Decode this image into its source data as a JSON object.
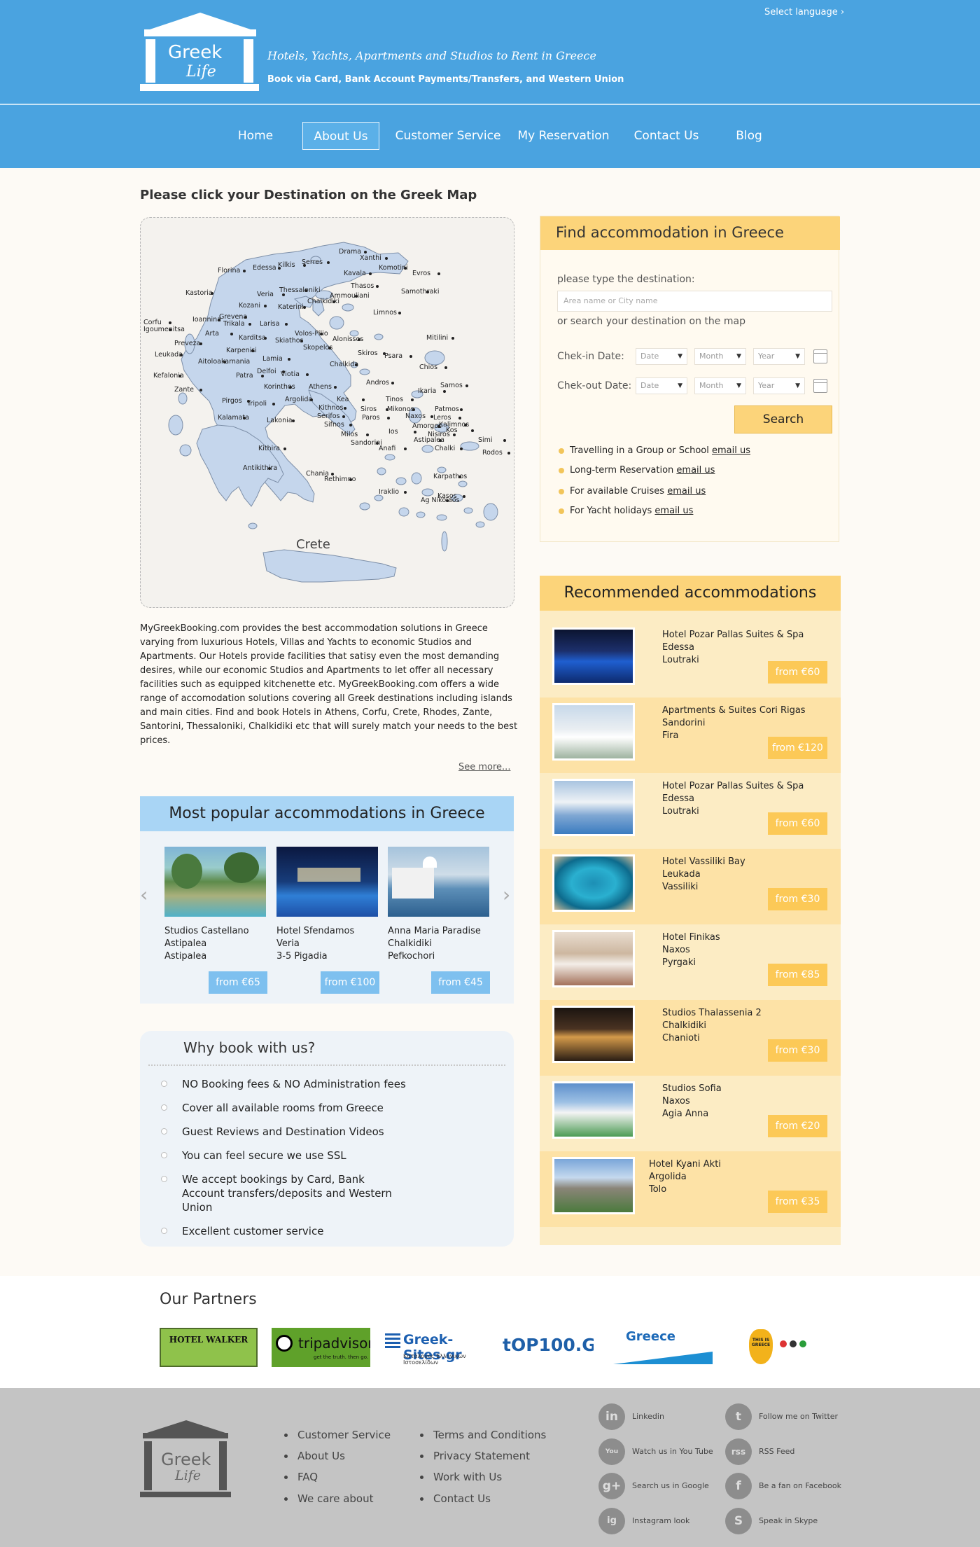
{
  "header": {
    "logo_line1": "Greek",
    "logo_line2": "Life",
    "tagline": "Hotels, Yachts, Apartments and Studios to Rent in Greece",
    "subtagline": "Book via Card, Bank Account Payments/Transfers, and Western Union",
    "select_language": "Select language ›"
  },
  "nav": {
    "items": [
      "Home",
      "About Us",
      "Customer Service",
      "My Reservation",
      "Contact Us",
      "Blog"
    ],
    "active": "About Us"
  },
  "map": {
    "title": "Please click your Destination on the Greek Map",
    "crete_label": "Crete",
    "cities": [
      "Drama",
      "Xanthi",
      "Komotini",
      "Evros",
      "Florina",
      "Edessa",
      "Kilkis",
      "Serres",
      "Kavala",
      "Thasos",
      "Samothraki",
      "Kastoria",
      "Veria",
      "Thessaloniki",
      "Ammouliani",
      "Chalkidiki",
      "Kozani",
      "Katerini",
      "Grevena",
      "Limnos",
      "Corfu",
      "Igoumenitsa",
      "Ioannina",
      "Trikala",
      "Larisa",
      "Volos-Pilio",
      "Arta",
      "Karditsa",
      "Skiathos",
      "Alonissos",
      "Mitilini",
      "Preveza",
      "Skopelos",
      "Karpenisi",
      "Skiros",
      "Psara",
      "Leukada",
      "Lamia",
      "Chalkida",
      "Chios",
      "Aitoloakarnania",
      "Delfoi",
      "Kefalonia",
      "Patra",
      "Viotia",
      "Andros",
      "Samos",
      "Zante",
      "Korinthos",
      "Athens",
      "Ikaria",
      "Argolida",
      "Kea",
      "Tinos",
      "Pirgos",
      "Tripoli",
      "Kithnos",
      "Mikonos",
      "Patmos",
      "Serifos",
      "Siros",
      "Paros",
      "Naxos",
      "Leros",
      "Kalimnos",
      "Kalamata",
      "Lakonia",
      "Sifnos",
      "Amorgos",
      "Kos",
      "Milos",
      "Ios",
      "Nisiros",
      "Sandorini",
      "Astipalea",
      "Simi",
      "Anafi",
      "Chalki",
      "Rodos",
      "Kithira",
      "Antikithira",
      "Karpathos",
      "Chania",
      "Rethimno",
      "Kasos",
      "Iraklio",
      "Ag Nikolaos"
    ]
  },
  "intro": {
    "text": "MyGreekBooking.com provides the best accommodation solutions in Greece varying from luxurious Hotels, Villas and Yachts to economic Studios and Apartments. Our Hotels provide facilities that satisy even the most demanding desires, while our economic Studios and Apartments to let offer all necessary facilities such as equipped kitchenette etc. MyGreekBooking.com offers a wide range of accomodation solutions covering all Greek destinations including islands and main cities. Find and book Hotels in Athens, Corfu, Crete, Rhodes, Zante, Santorini, Thessaloniki, Chalkidiki etc that will surely match your needs to the best prices.",
    "see_more": "See more..."
  },
  "popular": {
    "title": "Most popular accommodations in Greece",
    "items": [
      {
        "name": "Studios Castellano",
        "line2": "Astipalea",
        "line3": "Astipalea",
        "price": "from €65"
      },
      {
        "name": "Hotel Sfendamos",
        "line2": "Veria",
        "line3": "3-5 Pigadia",
        "price": "from €100"
      },
      {
        "name": "Anna Maria Paradise",
        "line2": "Chalkidiki",
        "line3": "Pefkochori",
        "price": "from €45"
      }
    ]
  },
  "why": {
    "title": "Why book with us?",
    "items": [
      "NO Booking fees & NO Administration fees",
      "Cover all available rooms from Greece",
      "Guest Reviews and Destination Videos",
      "You can feel secure we use SSL",
      "We accept bookings by Card, Bank Account transfers/deposits and Western Union",
      "Excellent customer service"
    ]
  },
  "find": {
    "title": "Find accommodation in Greece",
    "type_label": "please type the destination:",
    "placeholder": "Area name or City name",
    "or_map": "or search your destination on the map",
    "checkin": "Chek-in Date:",
    "checkout": "Chek-out Date:",
    "date": "Date",
    "month": "Month",
    "year": "Year",
    "search": "Search",
    "lines": [
      {
        "text": "Travelling in a Group or School",
        "link": "email us"
      },
      {
        "text": "Long-term Reservation",
        "link": "email us"
      },
      {
        "text": "For available Cruises",
        "link": "email us"
      },
      {
        "text": "For Yacht holidays",
        "link": "email us"
      }
    ]
  },
  "recommended": {
    "title": "Recommended accommodations",
    "items": [
      {
        "name": "Hotel Pozar Pallas Suites & Spa",
        "region": "Edessa",
        "town": "Loutraki",
        "price": "from €60"
      },
      {
        "name": "Apartments & Suites Cori Rigas",
        "region": "Sandorini",
        "town": "Fira",
        "price": "from €120"
      },
      {
        "name": "Hotel Pozar Pallas Suites & Spa",
        "region": "Edessa",
        "town": "Loutraki",
        "price": "from €60"
      },
      {
        "name": "Hotel Vassiliki Bay",
        "region": "Leukada",
        "town": "Vassiliki",
        "price": "from €30"
      },
      {
        "name": "Hotel Finikas",
        "region": "Naxos",
        "town": "Pyrgaki",
        "price": "from €85"
      },
      {
        "name": "Studios Thalassenia 2",
        "region": "Chalkidiki",
        "town": "Chanioti",
        "price": "from €30"
      },
      {
        "name": "Studios Sofia",
        "region": "Naxos",
        "town": "Agia Anna",
        "price": "from €20"
      },
      {
        "name": "Hotel Kyani Akti",
        "region": "Argolida",
        "town": "Tolo",
        "price": "from €35"
      }
    ]
  },
  "partners": {
    "title": "Our Partners",
    "items": [
      "HOTEL WALKER",
      "tripadvisor",
      "Greek-Sites.gr",
      "tOP100.GR",
      "Greece",
      "THIS IS GREECE"
    ],
    "tripadvisor_tag": "get the truth. then go.",
    "greeksites_sub": "Κατάλογος Ελληνικών Ιστοσελίδων"
  },
  "footer": {
    "logo_line1": "Greek",
    "logo_line2": "Life",
    "col1": [
      "Customer Service",
      "About Us",
      "FAQ",
      "We care about"
    ],
    "col2": [
      "Terms and Conditions",
      "Privacy Statement",
      "Work with Us",
      "Contact Us"
    ],
    "social": [
      {
        "icon": "in",
        "label": "Linkedin"
      },
      {
        "icon": "t",
        "label": "Follow me on Twitter"
      },
      {
        "icon": "You Tube",
        "label": "Watch us in You Tube"
      },
      {
        "icon": "rss",
        "label": "RSS Feed"
      },
      {
        "icon": "g+",
        "label": "Search us in Google"
      },
      {
        "icon": "f",
        "label": "Be a fan on Facebook"
      },
      {
        "icon": "ig",
        "label": "Instagram look"
      },
      {
        "icon": "S",
        "label": "Speak in Skype"
      }
    ]
  },
  "colors": {
    "header_blue": "#4aa3e0",
    "light_blue": "#a9d5f5",
    "yellow": "#fcd47a",
    "pale_yellow": "#fcecc4",
    "footer_gray": "#c4c4c4"
  }
}
